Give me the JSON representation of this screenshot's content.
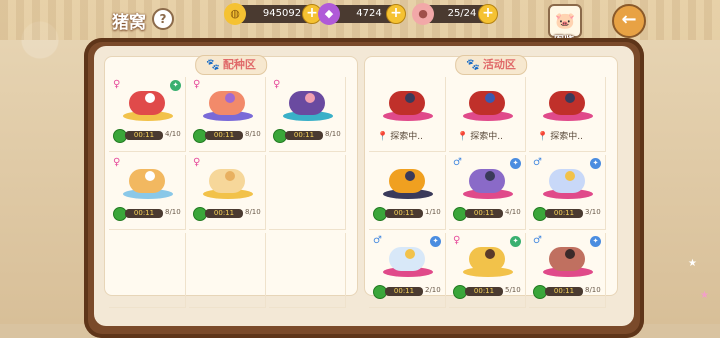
{
  "header": {
    "title": "猪窝",
    "help_icon": "?",
    "resources": [
      {
        "name": "gold",
        "value": "945092",
        "icon": "coin-icon"
      },
      {
        "name": "gem",
        "value": "4724",
        "icon": "gem-icon"
      },
      {
        "name": "capacity",
        "value": "25/24",
        "icon": "pig-icon"
      }
    ],
    "album_label": "图鉴"
  },
  "breed_panel": {
    "title": "配种区",
    "cells": [
      {
        "gender": "♀",
        "gender_type": "female",
        "badge": true,
        "colors": [
          "#e04a4a",
          "#ffffff"
        ],
        "platform": "#f2c24a",
        "timer": "00:11",
        "count": "4/10"
      },
      {
        "gender": "♀",
        "gender_type": "female",
        "badge": false,
        "colors": [
          "#f28a6a",
          "#a06ad0"
        ],
        "platform": "#7a6ad8",
        "timer": "00:11",
        "count": "8/10"
      },
      {
        "gender": "♀",
        "gender_type": "female",
        "badge": false,
        "colors": [
          "#6a4aa0",
          "#f2a0b0"
        ],
        "platform": "#3ab0c8",
        "timer": "00:11",
        "count": "8/10"
      },
      {
        "gender": "♀",
        "gender_type": "female",
        "badge": false,
        "colors": [
          "#f2b860",
          "#ffffff"
        ],
        "platform": "#8ac8e8",
        "timer": "00:11",
        "count": "8/10"
      },
      {
        "gender": "♀",
        "gender_type": "female",
        "badge": false,
        "colors": [
          "#f6d79a",
          "#e8b060"
        ],
        "platform": "#f2c24a",
        "timer": "00:11",
        "count": "8/10"
      }
    ]
  },
  "active_panel": {
    "title": "活动区",
    "cells": [
      {
        "gender": "",
        "gender_type": "",
        "badge": false,
        "colors": [
          "#c0302a",
          "#3a3a5a"
        ],
        "platform": "#e04a8a",
        "explore": "探索中.."
      },
      {
        "gender": "",
        "gender_type": "",
        "badge": false,
        "colors": [
          "#c0302a",
          "#3a5ab0"
        ],
        "platform": "#e04a8a",
        "explore": "探索中.."
      },
      {
        "gender": "",
        "gender_type": "",
        "badge": false,
        "colors": [
          "#c0302a",
          "#3a3a5a"
        ],
        "platform": "#e04a8a",
        "explore": "探索中.."
      },
      {
        "gender": "",
        "gender_type": "",
        "badge": false,
        "colors": [
          "#f0a020",
          "#3a3a5a"
        ],
        "platform": "#3a3a5a",
        "timer": "00:11",
        "count": "1/10"
      },
      {
        "gender": "♂",
        "gender_type": "male",
        "badge": true,
        "colors": [
          "#8a6ac8",
          "#3a3a5a"
        ],
        "platform": "#e04a8a",
        "timer": "00:11",
        "count": "4/10"
      },
      {
        "gender": "♂",
        "gender_type": "male",
        "badge": true,
        "colors": [
          "#c8d8f8",
          "#f2c24a"
        ],
        "platform": "#e04a8a",
        "timer": "00:11",
        "count": "3/10"
      },
      {
        "gender": "♂",
        "gender_type": "male",
        "badge": true,
        "colors": [
          "#d8e8f8",
          "#f2c24a"
        ],
        "platform": "#e04a8a",
        "timer": "00:11",
        "count": "2/10"
      },
      {
        "gender": "♀",
        "gender_type": "female",
        "badge": true,
        "colors": [
          "#f2c24a",
          "#5a3a2a"
        ],
        "platform": "#f2c24a",
        "timer": "00:11",
        "count": "5/10"
      },
      {
        "gender": "♂",
        "gender_type": "male",
        "badge": true,
        "colors": [
          "#c07060",
          "#3a2a2a"
        ],
        "platform": "#e04a8a",
        "timer": "00:11",
        "count": "8/10"
      }
    ]
  }
}
